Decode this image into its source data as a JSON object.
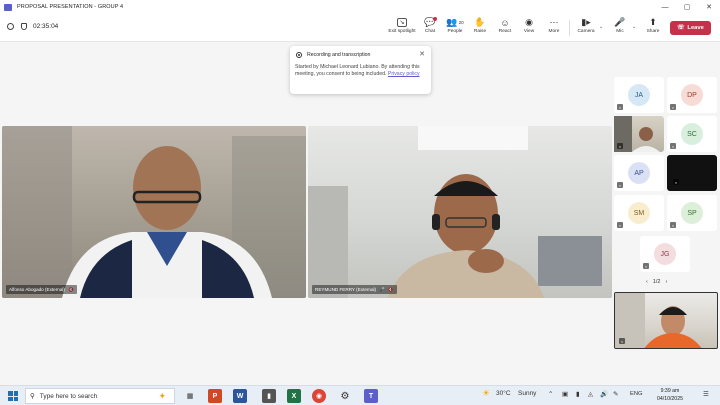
{
  "window": {
    "title": "PROPOSAL PRESENTATION - GROUP 4"
  },
  "toolbar": {
    "timer": "02:35:04",
    "buttons": [
      {
        "label": "Exit spotlight",
        "icon": "exit-spotlight-icon"
      },
      {
        "label": "Chat",
        "icon": "chat-icon"
      },
      {
        "label": "People",
        "icon": "people-icon",
        "count": "20"
      },
      {
        "label": "Raise",
        "icon": "raise-hand-icon"
      },
      {
        "label": "React",
        "icon": "react-icon"
      },
      {
        "label": "View",
        "icon": "view-icon"
      },
      {
        "label": "More",
        "icon": "more-icon"
      },
      {
        "label": "Camera",
        "icon": "camera-icon"
      },
      {
        "label": "Mic",
        "icon": "mic-icon"
      },
      {
        "label": "Share",
        "icon": "share-icon"
      }
    ],
    "leave_label": "Leave"
  },
  "banner": {
    "title": "Recording and transcription",
    "text": "Started by Michael Leonard Lubiano. By attending this meeting, you consent to being included. ",
    "link": "Privacy policy"
  },
  "videos": [
    {
      "name": "Alfonso Abogado (External)"
    },
    {
      "name": "REYMUND FERRY (External)"
    }
  ],
  "participants": [
    {
      "initials": "JA",
      "bg": "#d6e8f5",
      "fg": "#2b5d86"
    },
    {
      "initials": "DP",
      "bg": "#f7dcd6",
      "fg": "#9b3c2a"
    },
    {
      "initials": "",
      "bg": "#d0cabd",
      "fg": "#333333"
    },
    {
      "initials": "SC",
      "bg": "#d9efdd",
      "fg": "#2e6b3a"
    },
    {
      "initials": "AP",
      "bg": "#dbe1f5",
      "fg": "#3a4d8f"
    },
    {
      "initials": "",
      "bg": "#111111",
      "fg": "#ffffff"
    },
    {
      "initials": "SM",
      "bg": "#f8eecf",
      "fg": "#7d6118"
    },
    {
      "initials": "SP",
      "bg": "#dcefd9",
      "fg": "#3a6e33"
    },
    {
      "initials": "JG",
      "bg": "#f3dddf",
      "fg": "#8d3a46"
    }
  ],
  "pager": {
    "label": "1/2"
  },
  "taskbar": {
    "search_placeholder": "Type here to search",
    "weather_temp": "30°C",
    "weather_desc": "Sunny",
    "language": "ENG",
    "time": "9:39 am",
    "date": "04/10/2025"
  }
}
